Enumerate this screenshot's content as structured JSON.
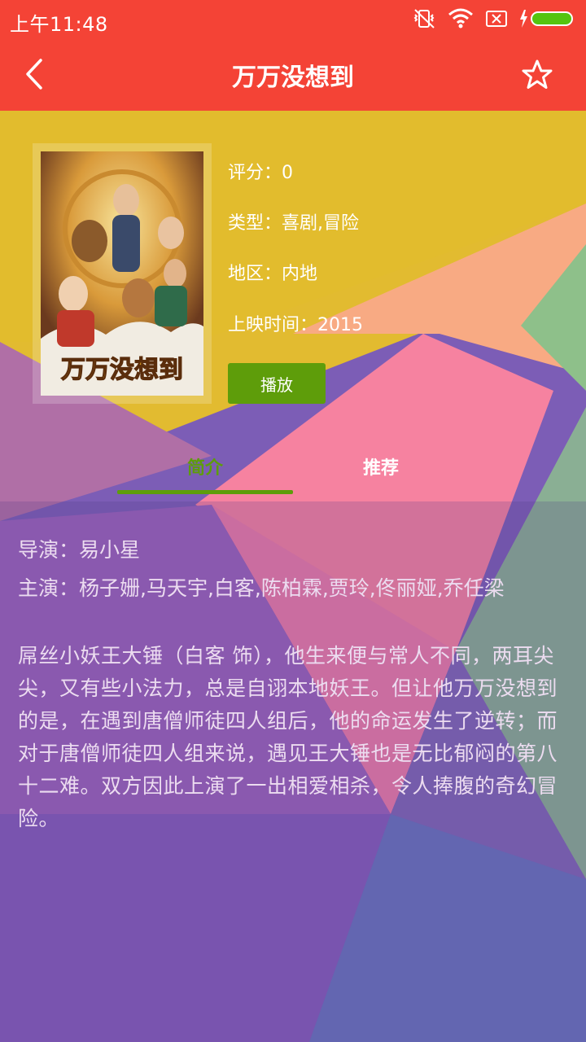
{
  "status_bar": {
    "time": "上午11:48"
  },
  "app_bar": {
    "title": "万万没想到",
    "back_icon": "chevron-left-icon",
    "favorite_icon": "star-outline-icon"
  },
  "movie": {
    "poster_alt": "万万没想到 poster",
    "rating_label": "评分：0",
    "genre_label": "类型：喜剧,冒险",
    "region_label": "地区：内地",
    "release_label": "上映时间：2015",
    "play_button": "播放"
  },
  "tabs": {
    "intro": "简介",
    "recommend": "推荐",
    "active": "简介"
  },
  "details": {
    "director": "导演：易小星",
    "cast": "主演：杨子姗,马天宇,白客,陈柏霖,贾玲,佟丽娅,乔任梁",
    "synopsis": "屌丝小妖王大锤（白客 饰），他生来便与常人不同，两耳尖尖，又有些小法力，总是自诩本地妖王。但让他万万没想到的是，在遇到唐僧师徒四人组后，他的命运发生了逆转；而对于唐僧师徒四人组来说，遇见王大锤也是无比郁闷的第八十二难。双方因此上演了一出相爱相杀，令人捧腹的奇幻冒险。"
  },
  "colors": {
    "primary": "#f44336",
    "accent_green": "#5e9d0a",
    "header_gold": "#e0bd2e"
  }
}
